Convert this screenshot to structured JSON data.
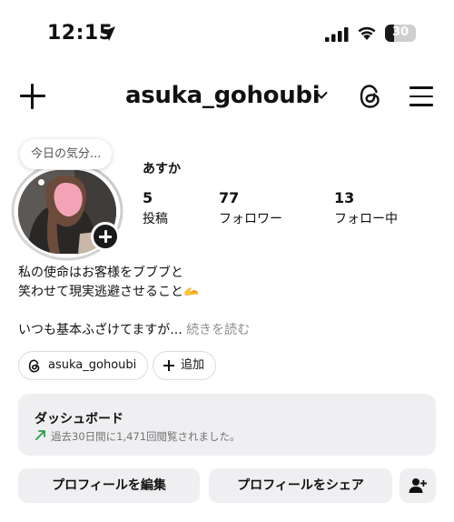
{
  "status_bar": {
    "time": "12:15",
    "battery_level": "30",
    "battery_fraction": 0.3
  },
  "header": {
    "username": "asuka_gohoubi"
  },
  "profile": {
    "note": "今日の気分...",
    "display_name": "あすか",
    "stats": [
      {
        "value": "5",
        "label": "投稿"
      },
      {
        "value": "77",
        "label": "フォロワー"
      },
      {
        "value": "13",
        "label": "フォロー中"
      }
    ],
    "bio_lines": [
      "私の使命はお客様をブブブと",
      "笑わせて現実逃避させること🫴"
    ],
    "bio_more_text": "いつも基本ふざけてますが...",
    "read_more": "続きを読む",
    "threads_chip": "asuka_gohoubi",
    "add_chip": "追加"
  },
  "dashboard": {
    "title": "ダッシュボード",
    "subtitle": "過去30日間に1,471回閲覧されました。"
  },
  "buttons": {
    "edit_profile": "プロフィールを編集",
    "share_profile": "プロフィールをシェア"
  },
  "icons": {
    "location": "location-arrow-icon",
    "signal": "cellular-signal-icon",
    "wifi": "wifi-icon",
    "add": "plus-icon",
    "chevron": "chevron-down-icon",
    "threads": "threads-icon",
    "menu": "hamburger-menu-icon",
    "trend": "trend-up-icon",
    "add_user": "add-person-icon"
  },
  "colors": {
    "trend_green": "#2c9a4a",
    "gradient_start": "#f58529",
    "gradient_end": "#dd2a7b"
  }
}
